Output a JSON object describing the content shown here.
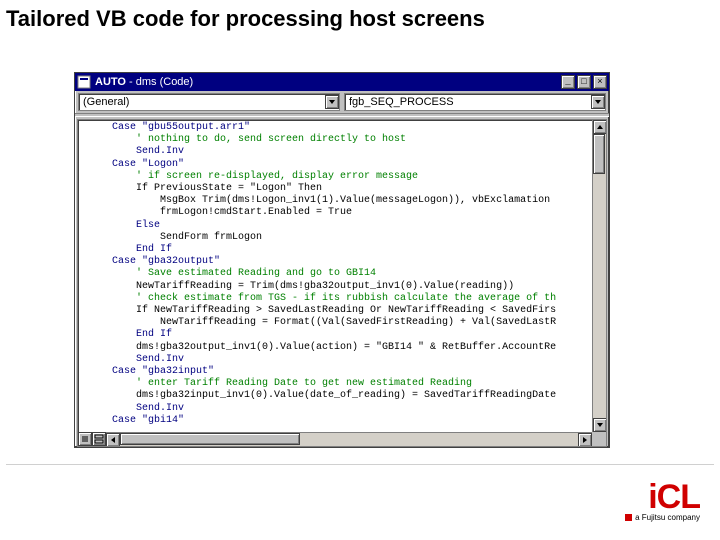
{
  "page_title": "Tailored VB code for processing host screens",
  "window": {
    "title_prefix": "AUTO",
    "title_suffix": "dms (Code)",
    "btn_min": "_",
    "btn_max": "□",
    "btn_close": "×"
  },
  "dropdown_left": "(General)",
  "dropdown_right": "fgb_SEQ_PROCESS",
  "logo": {
    "brand": "iCL",
    "tagline": "a Fujitsu company"
  },
  "code": {
    "lines": [
      {
        "t": "kw",
        "s": "Case \"gbu55output.arr1\""
      },
      {
        "t": "cm",
        "s": "    ' nothing to do, send screen directly to host"
      },
      {
        "t": "kw",
        "s": "    Send.Inv"
      },
      {
        "t": "kw",
        "s": "Case \"Logon\""
      },
      {
        "t": "cm",
        "s": "    ' if screen re-displayed, display error message"
      },
      {
        "t": "pl",
        "s": "    If PreviousState = \"Logon\" Then"
      },
      {
        "t": "pl",
        "s": "        MsgBox Trim(dms!Logon_inv1(1).Value(messageLogon)), vbExclamation"
      },
      {
        "t": "pl",
        "s": "        frmLogon!cmdStart.Enabled = True"
      },
      {
        "t": "kw",
        "s": "    Else"
      },
      {
        "t": "pl",
        "s": "        SendForm frmLogon"
      },
      {
        "t": "kw",
        "s": "    End If"
      },
      {
        "t": "kw",
        "s": "Case \"gba32output\""
      },
      {
        "t": "cm",
        "s": "    ' Save estimated Reading and go to GBI14"
      },
      {
        "t": "pl",
        "s": "    NewTariffReading = Trim(dms!gba32output_inv1(0).Value(reading))"
      },
      {
        "t": "cm",
        "s": "    ' check estimate from TGS - if its rubbish calculate the average of th"
      },
      {
        "t": "pl",
        "s": "    If NewTariffReading > SavedLastReading Or NewTariffReading < SavedFirs"
      },
      {
        "t": "pl",
        "s": "        NewTariffReading = Format((Val(SavedFirstReading) + Val(SavedLastR"
      },
      {
        "t": "kw",
        "s": "    End If"
      },
      {
        "t": "pl",
        "s": "    dms!gba32output_inv1(0).Value(action) = \"GBI14 \" & RetBuffer.AccountRe"
      },
      {
        "t": "kw",
        "s": "    Send.Inv"
      },
      {
        "t": "kw",
        "s": "Case \"gba32input\""
      },
      {
        "t": "cm",
        "s": "    ' enter Tariff Reading Date to get new estimated Reading"
      },
      {
        "t": "pl",
        "s": "    dms!gba32input_inv1(0).Value(date_of_reading) = SavedTariffReadingDate"
      },
      {
        "t": "kw",
        "s": "    Send.Inv"
      },
      {
        "t": "kw",
        "s": "Case \"gbi14\""
      }
    ]
  }
}
